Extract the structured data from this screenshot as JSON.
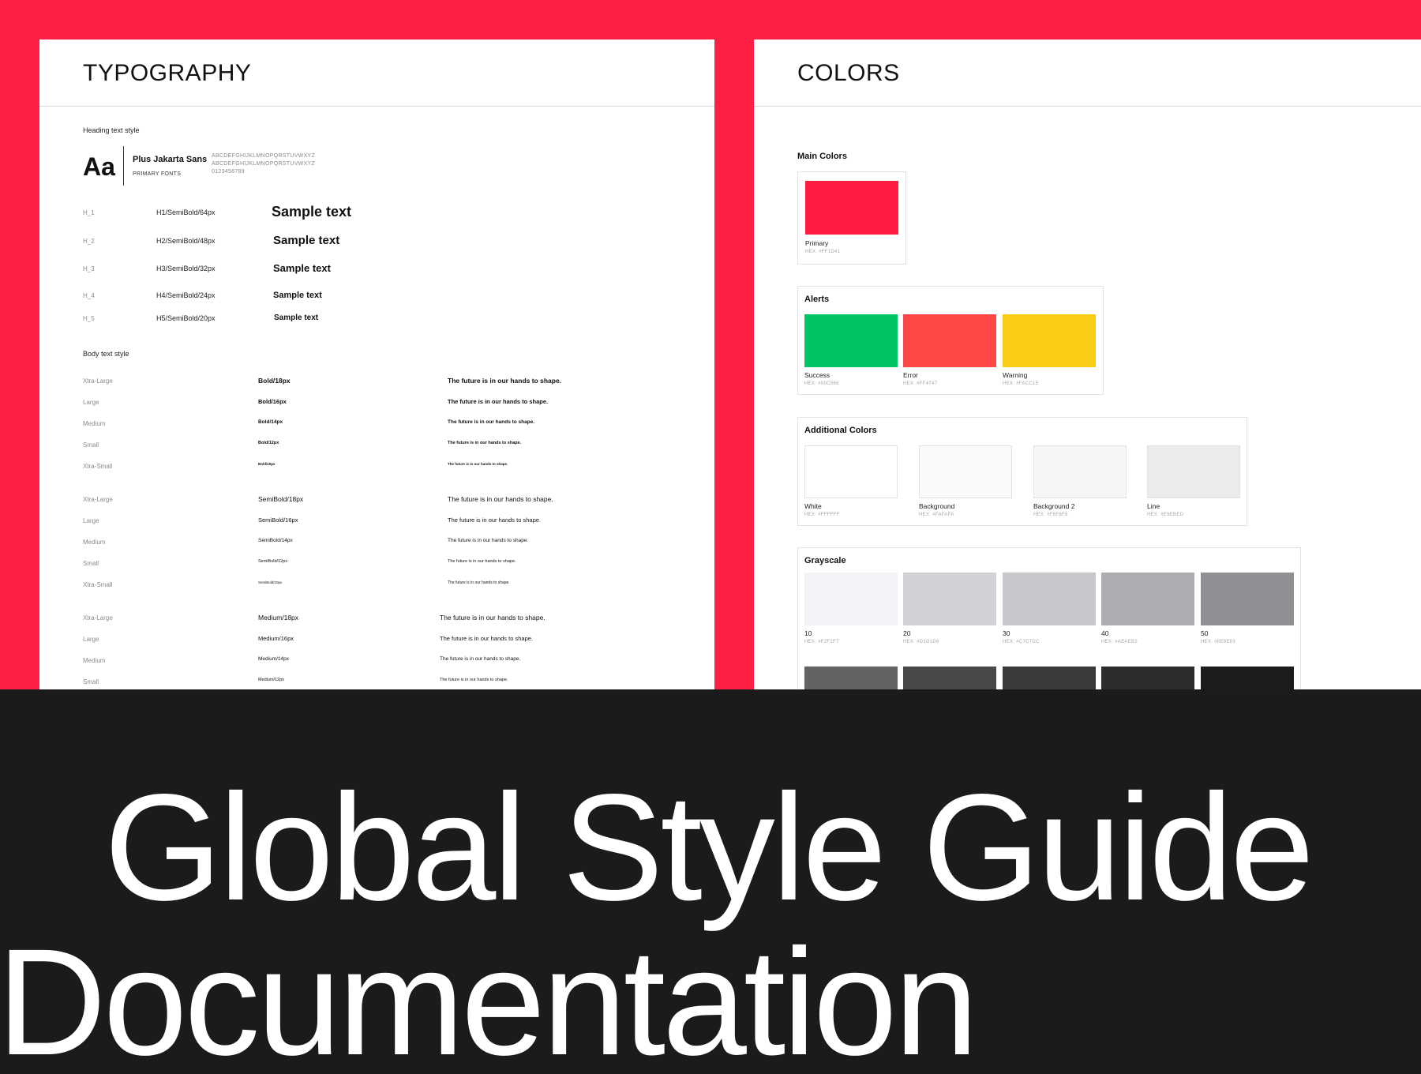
{
  "typography": {
    "title": "TYPOGRAPHY",
    "heading_section_label": "Heading text style",
    "aa_glyph": "Aa",
    "font_name": "Plus Jakarta Sans",
    "font_subtitle": "PRIMARY FONTS",
    "alphabet_upper": "ABCDEFGHIJKLMNOPQRSTUVWXYZ",
    "alphabet_lower": "ABCDEFGHIJKLMNOPQRSTUVWXYZ",
    "digits": "0123456789",
    "headings": [
      {
        "label": "H_1",
        "spec": "H1/SemiBold/64px",
        "sample": "Sample text"
      },
      {
        "label": "H_2",
        "spec": "H2/SemiBold/48px",
        "sample": "Sample text"
      },
      {
        "label": "H_3",
        "spec": "H3/SemiBold/32px",
        "sample": "Sample text"
      },
      {
        "label": "H_4",
        "spec": "H4/SemiBold/24px",
        "sample": "Sample text"
      },
      {
        "label": "H_5",
        "spec": "H5/SemiBold/20px",
        "sample": "Sample text"
      }
    ],
    "body_section_label": "Body text style",
    "body_groups": [
      {
        "weight": "Bold",
        "rows": [
          {
            "label": "Xtra-Large",
            "spec": "Bold/18px",
            "sample": "The future is in our hands to shape."
          },
          {
            "label": "Large",
            "spec": "Bold/16px",
            "sample": "The future is in our hands to shape."
          },
          {
            "label": "Medium",
            "spec": "Bold/14px",
            "sample": "The future is in our hands to shape."
          },
          {
            "label": "Small",
            "spec": "Bold/12px",
            "sample": "The future is in our hands to shape."
          },
          {
            "label": "Xtra-Small",
            "spec": "Bold/10px",
            "sample": "The future is in our hands to shape."
          }
        ]
      },
      {
        "weight": "SemiBold",
        "rows": [
          {
            "label": "Xtra-Large",
            "spec": "SemiBold/18px",
            "sample": "The future is in our hands to shape."
          },
          {
            "label": "Large",
            "spec": "SemiBold/16px",
            "sample": "The future is in our hands to shape."
          },
          {
            "label": "Medium",
            "spec": "SemiBold/14px",
            "sample": "The future is in our hands to shape."
          },
          {
            "label": "Small",
            "spec": "SemiBold/12px",
            "sample": "The future is in our hands to shape."
          },
          {
            "label": "Xtra-Small",
            "spec": "SemiBold/10px",
            "sample": "The future is in our hands to shape."
          }
        ]
      },
      {
        "weight": "Medium",
        "rows": [
          {
            "label": "Xtra-Large",
            "spec": "Medium/18px",
            "sample": "The future is in our hands to shape."
          },
          {
            "label": "Large",
            "spec": "Medium/16px",
            "sample": "The future is in our hands to shape."
          },
          {
            "label": "Medium",
            "spec": "Medium/14px",
            "sample": "The future is in our hands to shape."
          },
          {
            "label": "Small",
            "spec": "Medium/12px",
            "sample": "The future is in our hands to shape."
          }
        ]
      }
    ]
  },
  "colors": {
    "title": "COLORS",
    "main": {
      "title": "Main Colors",
      "swatches": [
        {
          "name": "Primary",
          "hex_label": "HEX: #FF1D41",
          "color": "#FF1D41"
        }
      ]
    },
    "alerts": {
      "title": "Alerts",
      "swatches": [
        {
          "name": "Success",
          "hex_label": "HEX: #00C566",
          "color": "#00C566"
        },
        {
          "name": "Error",
          "hex_label": "HEX: #FF4747",
          "color": "#FF4747"
        },
        {
          "name": "Warning",
          "hex_label": "HEX: #FACC15",
          "color": "#FACC15"
        }
      ]
    },
    "additional": {
      "title": "Additional Colors",
      "swatches": [
        {
          "name": "White",
          "hex_label": "HEX: #FFFFFF",
          "color": "#FFFFFF"
        },
        {
          "name": "Background",
          "hex_label": "HEX: #FAFAFA",
          "color": "#FAFAFA"
        },
        {
          "name": "Background 2",
          "hex_label": "HEX: #F6F6F6",
          "color": "#F6F6F6"
        },
        {
          "name": "Line",
          "hex_label": "HEX: #E9EBED",
          "color": "#E9EBED"
        }
      ]
    },
    "grayscale": {
      "title": "Grayscale",
      "swatches": [
        {
          "name": "10",
          "hex_label": "HEX: #F2F2F7",
          "color": "#F2F2F7"
        },
        {
          "name": "20",
          "hex_label": "HEX: #D1D1D6",
          "color": "#D1D1D6"
        },
        {
          "name": "30",
          "hex_label": "HEX: #C7C7CC",
          "color": "#C7C7CC"
        },
        {
          "name": "40",
          "hex_label": "HEX: #AEAEB2",
          "color": "#AEAEB2"
        },
        {
          "name": "50",
          "hex_label": "HEX: #8E8E93",
          "color": "#8E8E93"
        }
      ],
      "swatches_row2_colors": [
        "#636366",
        "#48484A",
        "#3A3A3C",
        "#2C2C2E",
        "#1C1C1E"
      ]
    }
  },
  "banner": {
    "line1": "Global Style Guide",
    "line2": "Documentation",
    "background": "#1B1B1B",
    "text_color": "#FFFFFF"
  },
  "theme": {
    "accent": "#FF1F44"
  }
}
